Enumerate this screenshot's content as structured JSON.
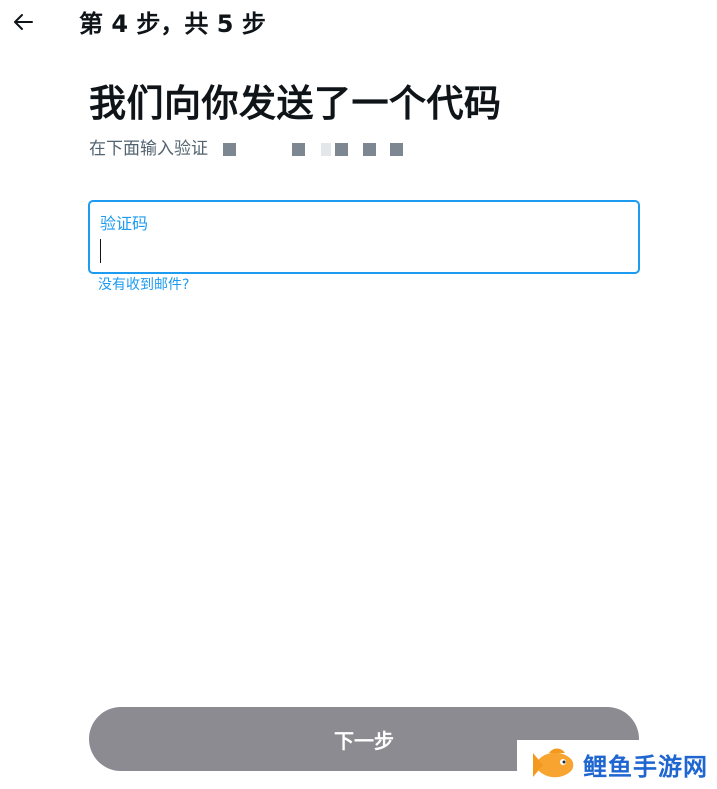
{
  "header": {
    "back_icon": "arrow-left-icon",
    "step_title": "第 4 步，共 5 步"
  },
  "main": {
    "heading": "我们向你发送了一个代码",
    "subtitle": "在下面输入验证",
    "code_field": {
      "label": "验证码",
      "value": ""
    },
    "resend_link": "没有收到邮件?",
    "next_button": "下一步"
  },
  "watermark": {
    "logo_icon": "fish-logo-icon",
    "text": "鲤鱼手游网"
  },
  "colors": {
    "accent": "#1d9bf0",
    "text_primary": "#0f1419",
    "text_secondary": "#536471",
    "button_disabled": "#8b8b91",
    "watermark_text": "#1f66d1",
    "watermark_logo": "#f7a530"
  }
}
